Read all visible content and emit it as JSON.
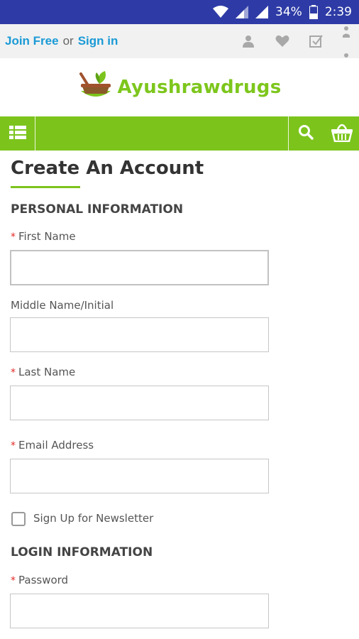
{
  "status_bar": {
    "battery": "34%",
    "time": "2:39"
  },
  "top_links": {
    "join_free": "Join Free",
    "or": "or",
    "sign_in": "Sign in",
    "icons": [
      "user-icon",
      "heart-icon",
      "checklist-icon",
      "more-vertical-icon"
    ]
  },
  "logo": {
    "text": "Ayushrawdrugs",
    "icon": "mortar-leaf-logo"
  },
  "nav": {
    "menu_icon": "list-menu-icon",
    "search_icon": "search-icon",
    "cart_icon": "basket-icon"
  },
  "colors": {
    "status_bar": "#2e3ba6",
    "brand_green": "#7cc41c",
    "link_blue": "#1a9ad6",
    "required_red": "#e02b27"
  },
  "form": {
    "title": "Create An Account",
    "personal_section": "PERSONAL INFORMATION",
    "first_name_label": "First Name",
    "middle_name_label": "Middle Name/Initial",
    "last_name_label": "Last Name",
    "email_label": "Email Address",
    "newsletter_label": "Sign Up for Newsletter",
    "login_section": "LOGIN INFORMATION",
    "password_label": "Password",
    "required_mark": "*"
  }
}
